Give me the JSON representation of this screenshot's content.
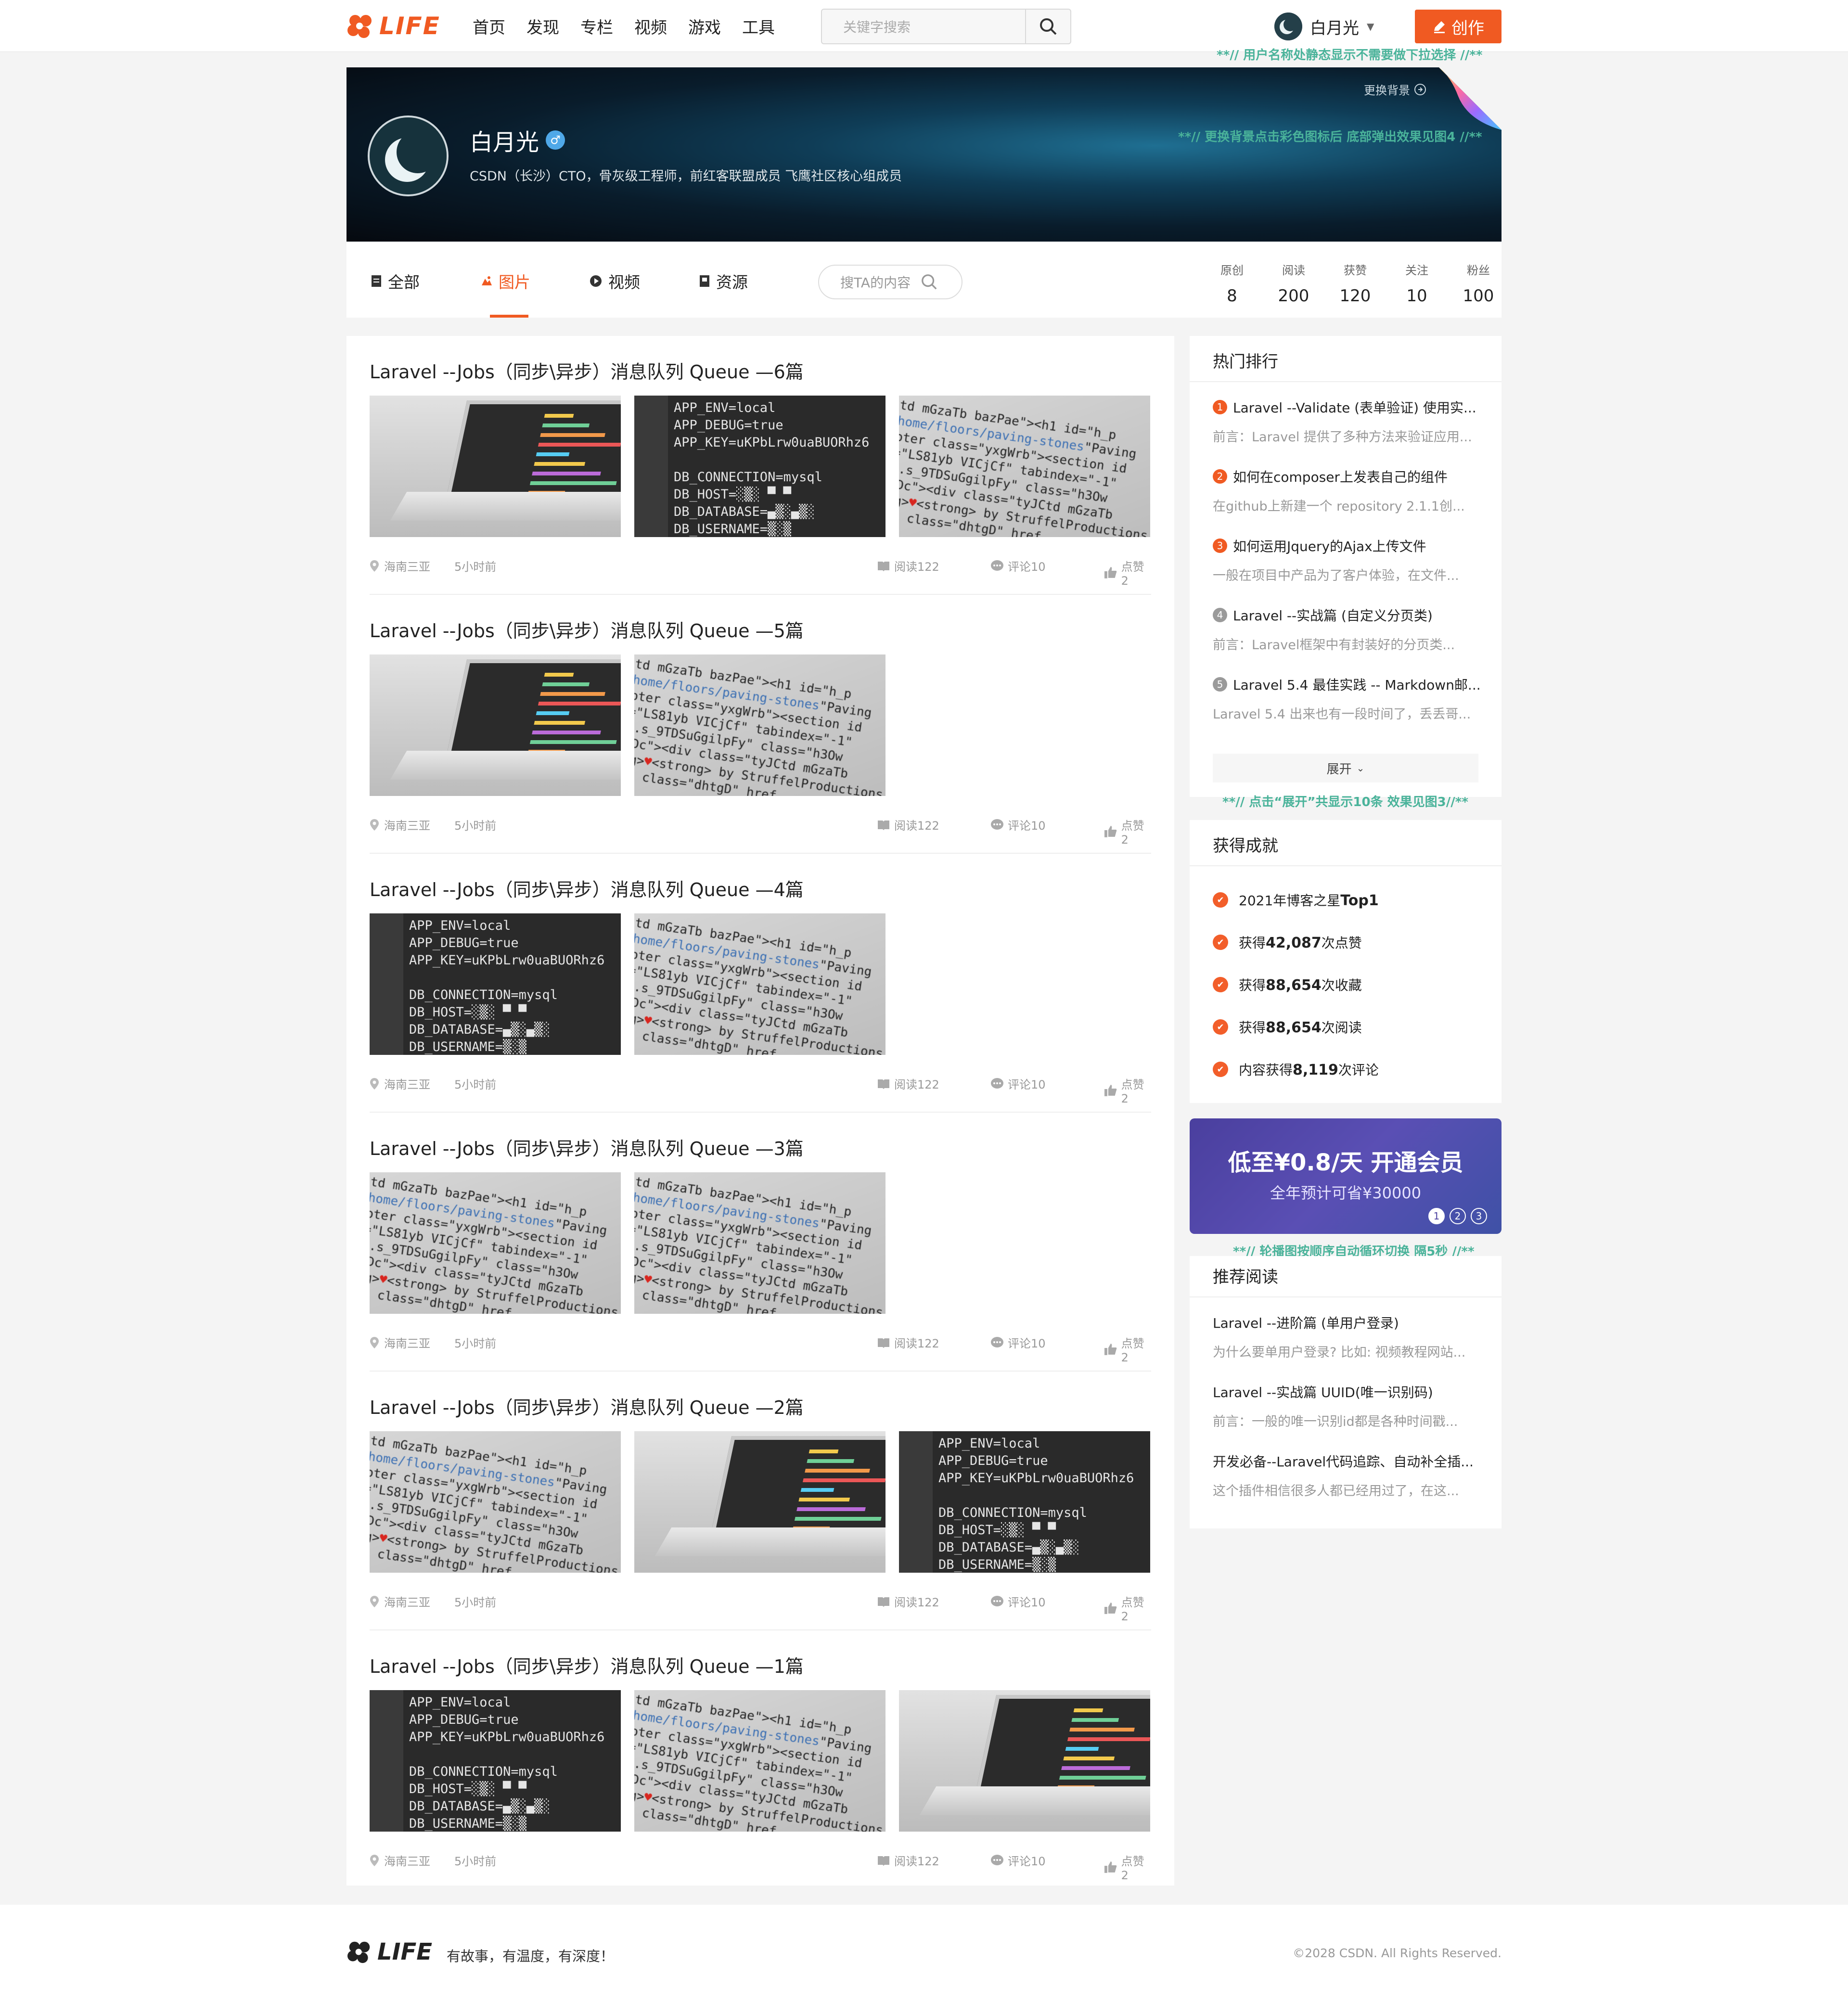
{
  "brand": {
    "logo_text": "LIFE",
    "logo_color": "#f05a22"
  },
  "nav": {
    "items": [
      "首页",
      "发现",
      "专栏",
      "视频",
      "游戏",
      "工具"
    ]
  },
  "search": {
    "placeholder": "关键字搜索"
  },
  "user": {
    "name": "白月光",
    "create_label": "创作"
  },
  "notes": {
    "username": "**// 用户名称处静态显示不需要做下拉选择 //**",
    "background": "**// 更换背景点击彩色图标后 底部弹出效果见图4 //**",
    "expand": "**// 点击“展开”共显示10条  效果见图3//**",
    "carousel": "**// 轮播图按顺序自动循环切换 隔5秒 //**"
  },
  "banner": {
    "change_bg": "更换背景",
    "name": "白月光",
    "desc": "CSDN（长沙）CTO，骨灰级工程师，前红客联盟成员 飞鹰社区核心组成员"
  },
  "tabs": [
    {
      "label": "全部",
      "icon": "document-icon"
    },
    {
      "label": "图片",
      "icon": "image-icon",
      "active": true
    },
    {
      "label": "视频",
      "icon": "play-icon"
    },
    {
      "label": "资源",
      "icon": "file-icon"
    }
  ],
  "tab_search": {
    "placeholder": "搜TA的内容"
  },
  "stats": [
    {
      "label": "原创",
      "value": "8"
    },
    {
      "label": "阅读",
      "value": "200"
    },
    {
      "label": "获赞",
      "value": "120"
    },
    {
      "label": "关注",
      "value": "10"
    },
    {
      "label": "粉丝",
      "value": "100"
    }
  ],
  "posts": [
    {
      "title": "Laravel --Jobs（同步\\异步）消息队列 Queue —6篇",
      "thumbs": [
        "laptop",
        "env",
        "code"
      ],
      "location": "海南三亚",
      "time": "5小时前",
      "reads": "阅读122",
      "comments": "评论10",
      "likes": "点赞2"
    },
    {
      "title": "Laravel --Jobs（同步\\异步）消息队列 Queue —5篇",
      "thumbs": [
        "laptop",
        "code"
      ],
      "location": "海南三亚",
      "time": "5小时前",
      "reads": "阅读122",
      "comments": "评论10",
      "likes": "点赞2"
    },
    {
      "title": "Laravel --Jobs（同步\\异步）消息队列 Queue —4篇",
      "thumbs": [
        "env",
        "code"
      ],
      "location": "海南三亚",
      "time": "5小时前",
      "reads": "阅读122",
      "comments": "评论10",
      "likes": "点赞2"
    },
    {
      "title": "Laravel --Jobs（同步\\异步）消息队列 Queue —3篇",
      "thumbs": [
        "code",
        "code"
      ],
      "location": "海南三亚",
      "time": "5小时前",
      "reads": "阅读122",
      "comments": "评论10",
      "likes": "点赞2"
    },
    {
      "title": "Laravel --Jobs（同步\\异步）消息队列 Queue —2篇",
      "thumbs": [
        "code",
        "laptop",
        "env"
      ],
      "location": "海南三亚",
      "time": "5小时前",
      "reads": "阅读122",
      "comments": "评论10",
      "likes": "点赞2"
    },
    {
      "title": "Laravel --Jobs（同步\\异步）消息队列 Queue —1篇",
      "thumbs": [
        "env",
        "code",
        "laptop"
      ],
      "location": "海南三亚",
      "time": "5小时前",
      "reads": "阅读122",
      "comments": "评论10",
      "likes": "点赞2"
    }
  ],
  "code_snippets": {
    "env": "APP_ENV=local\nAPP_DEBUG=true\nAPP_KEY=uKPbLrw0uaBUORhz6\n\nDB_CONNECTION=mysql\nDB_HOST=░▒░ ▀ ▀\nDB_DATABASE=▄▒░▄▒░\nDB_USERNAME=▒░▒\nDB_PASSWORD=░▒░",
    "code": "td mGzaTb bazPae\"><h1 id=\"h_p\nhome/floors/paving-stones\"Paving\noter class=\"yxgWrb\"><section id\n=\"LS81yb VICjCf\" tabindex=\"-1\"\nh.s_9TDSuGgilpFy\" class=\"h3Ow\nZDc\"><div class=\"tyJCtd mGzaTb\nng>♥<strong> by StruffelProductions\n<a class=\"dhtgD\" href"
  },
  "hot": {
    "title": "热门排行",
    "items": [
      {
        "n": "1",
        "title": "Laravel --Validate (表单验证) 使用实...",
        "desc": "前言：Laravel 提供了多种方法来验证应用..."
      },
      {
        "n": "2",
        "title": "如何在composer上发表自己的组件",
        "desc": "在github上新建一个 repository 2.1.1创..."
      },
      {
        "n": "3",
        "title": "如何运用Jquery的Ajax上传文件",
        "desc": "一般在项目中产品为了客户体验，在文件..."
      },
      {
        "n": "4",
        "title": "Laravel --实战篇 (自定义分页类)",
        "desc": "前言：Laravel框架中有封装好的分页类..."
      },
      {
        "n": "5",
        "title": "Laravel 5.4 最佳实践 -- Markdown邮...",
        "desc": "Laravel 5.4 出来也有一段时间了，丢丢哥..."
      }
    ],
    "expand_label": "展开"
  },
  "colors": {
    "rank_top": "#f05a22",
    "rank_rest": "#9a9a9a"
  },
  "achievements": {
    "title": "获得成就",
    "items": [
      {
        "pre": "2021年博客之星",
        "bold": "Top1",
        "post": ""
      },
      {
        "pre": "获得",
        "bold": "42,087",
        "post": "次点赞"
      },
      {
        "pre": "获得",
        "bold": "88,654",
        "post": "次收藏"
      },
      {
        "pre": "获得",
        "bold": "88,654",
        "post": "次阅读"
      },
      {
        "pre": "内容获得",
        "bold": "8,119",
        "post": "次评论"
      }
    ]
  },
  "vip": {
    "title": "低至¥0.8/天 开通会员",
    "subtitle": "全年预计可省¥30000",
    "dots": [
      "1",
      "2",
      "3"
    ],
    "active_dot": "1"
  },
  "recommend": {
    "title": "推荐阅读",
    "items": [
      {
        "title": "Laravel --进阶篇 (单用户登录)",
        "desc": "为什么要单用户登录? 比如: 视频教程网站..."
      },
      {
        "title": "Laravel --实战篇 UUID(唯一识别码)",
        "desc": "前言：一般的唯一识别id都是各种时间戳..."
      },
      {
        "title": "开发必备--Laravel代码追踪、自动补全插...",
        "desc": "这个插件相信很多人都已经用过了，在这..."
      }
    ]
  },
  "footer": {
    "logo_text": "LIFE",
    "slogan": "有故事，有温度，有深度！",
    "copyright": "©2028 CSDN. All Rights Reserved."
  }
}
